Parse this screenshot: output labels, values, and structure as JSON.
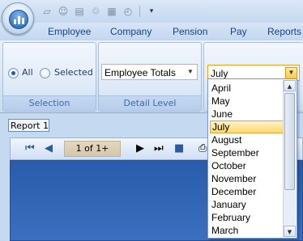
{
  "ribbon_tabs": [
    "Employee",
    "Company",
    "Pension",
    "Pay",
    "Reports"
  ],
  "selection_group": {
    "label": "Selection",
    "options": [
      {
        "label": "All",
        "selected": true
      },
      {
        "label": "Selected",
        "selected": false
      }
    ]
  },
  "detail_group": {
    "label": "Detail Level",
    "value": "Employee Totals"
  },
  "month_combo": {
    "value": "July",
    "options": [
      "April",
      "May",
      "June",
      "July",
      "August",
      "September",
      "October",
      "November",
      "December",
      "January",
      "February",
      "March"
    ],
    "selected_index": 3
  },
  "report": {
    "tab_label": "Report 1",
    "page_indicator": "1 of 1+"
  },
  "colors": {
    "ribbon_text": "#15428b",
    "viewer_background": "#2a5cac",
    "dropdown_highlight": "#ffd96c"
  }
}
